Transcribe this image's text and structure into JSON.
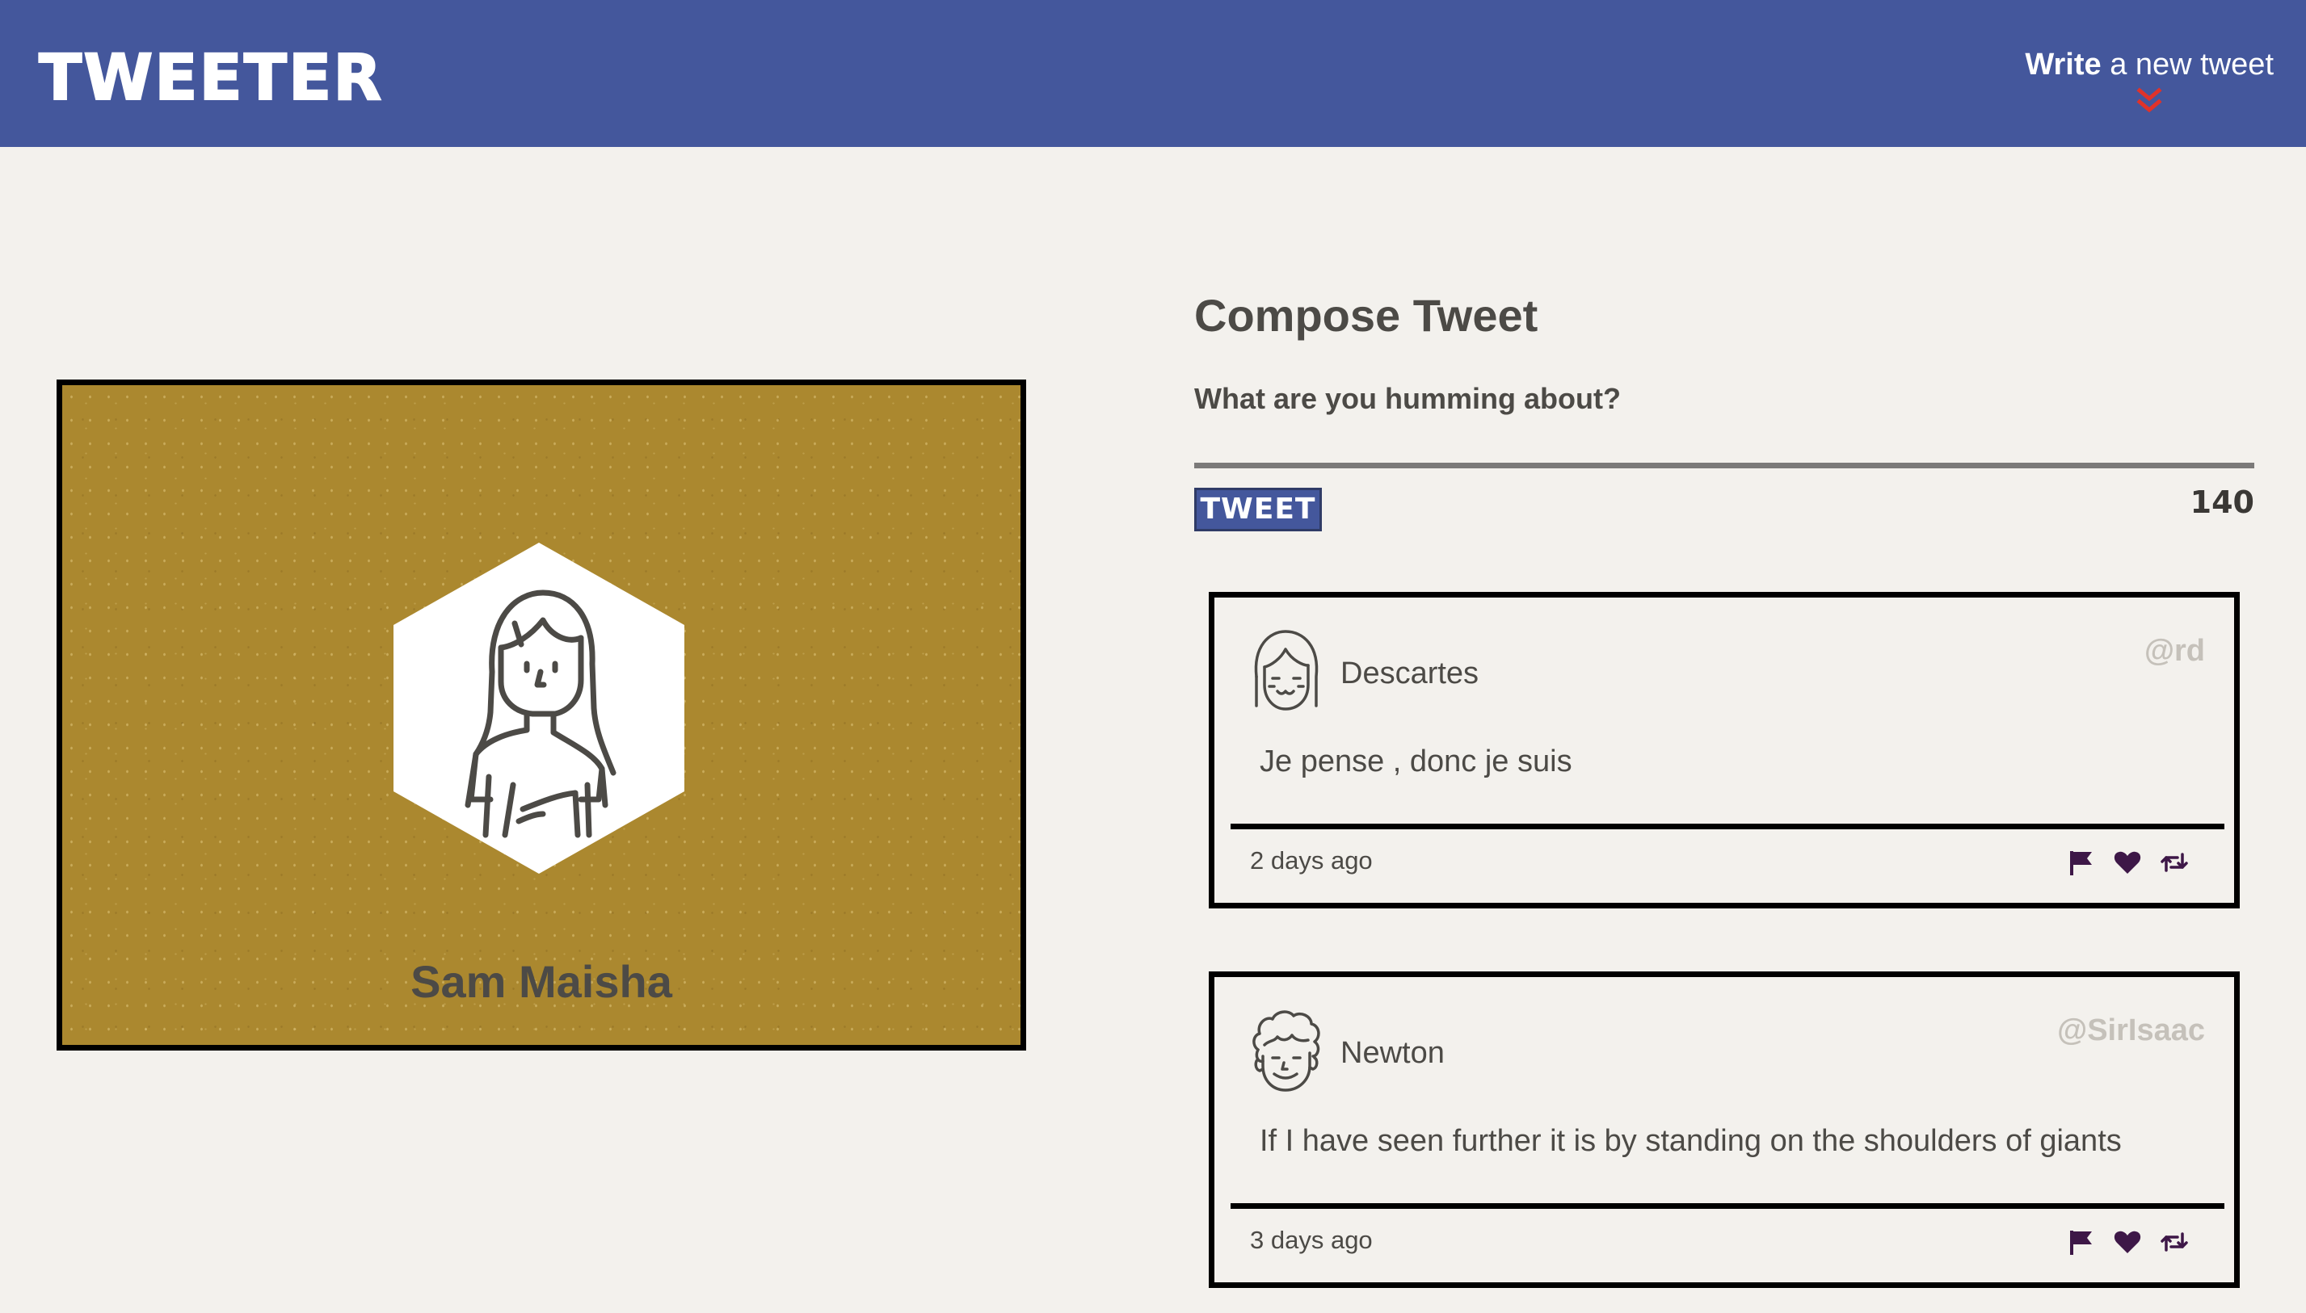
{
  "nav": {
    "brand": "TWEETER",
    "write_bold": "Write",
    "write_rest": " a new tweet",
    "chevron_icon": "double-chevron-down-icon",
    "chevron_color": "#e0322a"
  },
  "colors": {
    "nav_bg": "#44579c",
    "page_bg": "#f3f1ed",
    "profile_bg": "#ab882f",
    "action_icon": "#3d1747"
  },
  "profile": {
    "name": "Sam Maisha",
    "avatar_icon": "woman-avatar-icon"
  },
  "compose": {
    "title": "Compose Tweet",
    "label": "What are you humming about?",
    "input_value": "",
    "button_label": "TWEET",
    "counter": "140"
  },
  "tweets": [
    {
      "author": "Descartes",
      "handle": "@rd",
      "text": "Je pense , donc je suis",
      "timestamp": "2 days ago",
      "avatar_icon": "bob-haircut-avatar-icon",
      "actions": [
        "flag-icon",
        "heart-icon",
        "retweet-icon"
      ]
    },
    {
      "author": "Newton",
      "handle": "@SirIsaac",
      "text": "If I have seen further it is by standing on the shoulders of giants",
      "timestamp": "3 days ago",
      "avatar_icon": "curly-hair-avatar-icon",
      "actions": [
        "flag-icon",
        "heart-icon",
        "retweet-icon"
      ]
    }
  ]
}
